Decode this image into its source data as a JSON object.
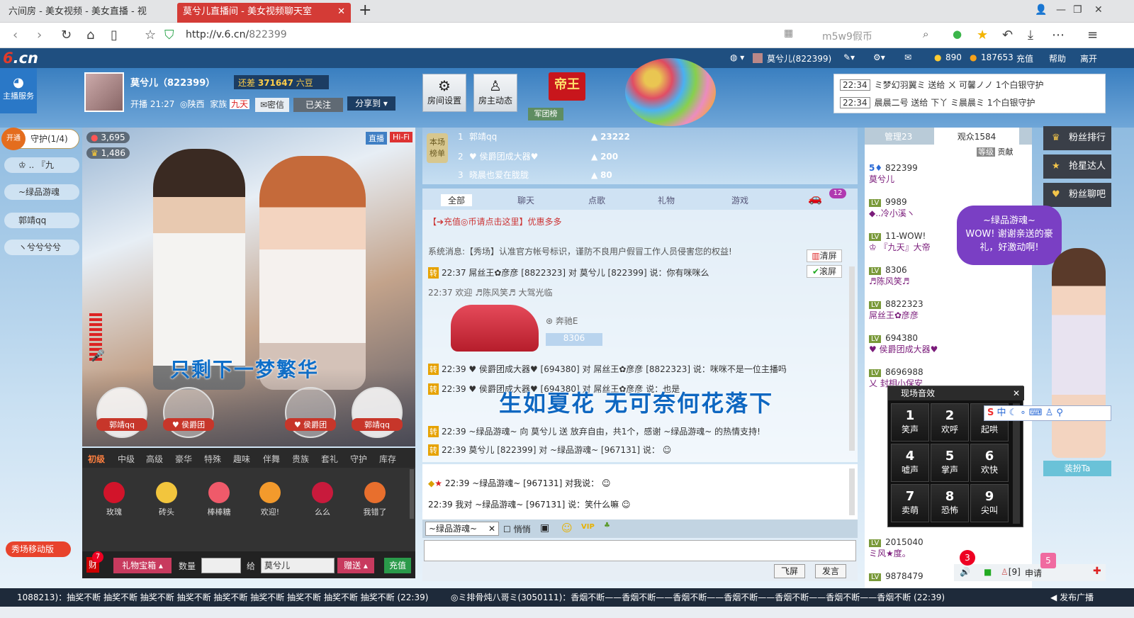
{
  "browser": {
    "tabs": [
      {
        "label": "六间房 - 美女视频 - 美女直播 - 视"
      },
      {
        "label": "莫兮儿直播间 - 美女视频聊天室"
      }
    ],
    "url_host": "http://v.6.cn/",
    "url_path": "822399",
    "search_placeholder": "m5w9假币"
  },
  "topbar": {
    "logo": "6.cn",
    "user": "莫兮儿(822399)",
    "coins": "890",
    "beans": "187653",
    "recharge": "充值",
    "help": "帮助",
    "leave": "离开"
  },
  "header": {
    "service": "主播服务",
    "host_name": "莫兮儿（822399）",
    "gold_label": "还差",
    "gold_value": "371647",
    "gold_suffix": "六豆",
    "live_time": "开播 21:27",
    "location": "陕西",
    "family_label": "家族",
    "family_tag": "九天",
    "secret": "密信",
    "followed": "已关注",
    "share": "分享到",
    "room_settings": "房间设置",
    "host_dynamic": "房主动态",
    "emperor": "帝王",
    "army": "军团榜"
  },
  "gift_notice": [
    {
      "time": "22:34",
      "text": "ミ梦幻羽翼ミ 送给 ㄨ 可馨ノノ 1个白银守护"
    },
    {
      "time": "22:34",
      "text": "晨晨二号 送给 下丫 ミ晨晨ミ 1个白银守护"
    }
  ],
  "guard": {
    "open": "开通",
    "title": "守护(1/4)",
    "members": [
      "♔ .. 『九",
      "~绿品游魂",
      "郭靖qq",
      "ヽ兮兮兮兮"
    ]
  },
  "video": {
    "wealth": "3,695",
    "fans": "1,486",
    "tag_live": "直播",
    "tag_hifi": "Hi-Fi",
    "lyric_top": "只剩下一梦繁华",
    "fan_seats": [
      "郭靖qq",
      "♥ 侯爵团",
      "♥ 侯爵团",
      "郭靖qq"
    ]
  },
  "gift_panel": {
    "tabs": [
      "初级",
      "中级",
      "高级",
      "豪华",
      "特殊",
      "趣味",
      "伴舞",
      "贵族",
      "套礼",
      "守护",
      "库存"
    ],
    "items": [
      "玫瑰",
      "砖头",
      "棒棒糖",
      "欢迎!",
      "么么",
      "我错了"
    ],
    "gift_box": "礼物宝箱",
    "qty_label": "数量",
    "to_label": "给",
    "recipient": "莫兮儿",
    "send": "赠送",
    "recharge": "充值",
    "badge": "7",
    "wealth_label": "财"
  },
  "rank": {
    "label": "本场榜单",
    "rows": [
      {
        "num": "1",
        "name": "郭靖qq",
        "score": "23222"
      },
      {
        "num": "2",
        "name": "♥ 侯爵团成大器♥",
        "score": "200"
      },
      {
        "num": "3",
        "name": "晓晨也爱在胧胧",
        "score": "80"
      }
    ]
  },
  "chat_tabs": [
    "全部",
    "聊天",
    "点歌",
    "礼物",
    "游戏"
  ],
  "car_badge": "12",
  "chat": {
    "notice": "【➔充值◎币请点击这里】优惠多多",
    "system": "系统消息:【秀场】认准官方帐号标识，谨防不良用户假冒工作人员侵害您的权益!",
    "clear": "清屏",
    "scroll": "滚屏",
    "lines": [
      "22:37 屌丝王✿彦彦 [8822323] 对 莫兮儿 [822399] 说：你有咪咪么",
      "22:37 欢迎 ♬陈风笑♬ 大驾光临",
      "22:39 ♥ 侯爵团成大器♥ [694380] 对 屌丝王✿彦彦 [8822323] 说：咪咪不是一位主播吗",
      "22:39 ♥ 侯爵团成大器♥ [694380] 对 屌丝王✿彦彦 说：也是",
      "22:39 ~绿品游魂~ 向 莫兮儿 送 放弃自由，共1个，感谢 ~绿品游魂~ 的热情支持!",
      "22:39 莫兮儿 [822399] 对 ~绿品游魂~ [967131] 说："
    ],
    "car_name": "奔驰E",
    "car_id": "8306",
    "lyric_bottom": "生如夏花  无可奈何花落下",
    "private": [
      "22:39 ~绿品游魂~ [967131] 对我说：",
      "22:39 我对 ~绿品游魂~ [967131] 说：笑什么嘛"
    ],
    "target": "~绿品游魂~",
    "whisper": "悄悄",
    "fly": "飞屏",
    "send": "发言"
  },
  "users": {
    "tab_admin": "管理23",
    "tab_audience": "观众1584",
    "rank_level": "等级",
    "rank_contrib": "贡献",
    "list": [
      {
        "id": "822399",
        "name": "莫兮儿"
      },
      {
        "id": "9989",
        "name": "◆..冷小溪ヽ"
      },
      {
        "id": "11-WOW!",
        "name": "♔ 『九天』大帝"
      },
      {
        "id": "8306",
        "name": "♬陈风笑♬"
      },
      {
        "id": "8822323",
        "name": "屌丝王✿彦彦"
      },
      {
        "id": "694380",
        "name": "♥ 侯爵团成大器♥"
      },
      {
        "id": "8696988",
        "name": "乂 封相小保安"
      },
      {
        "id": "2015040",
        "name": "ミ风★度。"
      },
      {
        "id": "9878479",
        "name": ""
      }
    ]
  },
  "right_side": {
    "fans_rank": "粉丝排行",
    "grab": "抢星达人",
    "fans_chat": "粉丝聊吧",
    "bubble_title": "~绿品游魂~",
    "bubble_text": "WOW! 谢谢亲送的豪礼，好激动啊!",
    "dress": "装扮Ta"
  },
  "sfx": {
    "title": "现场音效",
    "keys": [
      {
        "num": "1",
        "label": "笑声"
      },
      {
        "num": "2",
        "label": "欢呼"
      },
      {
        "num": "3",
        "label": "起哄"
      },
      {
        "num": "4",
        "label": "嘘声"
      },
      {
        "num": "5",
        "label": "掌声"
      },
      {
        "num": "6",
        "label": "欢快"
      },
      {
        "num": "7",
        "label": "卖萌"
      },
      {
        "num": "8",
        "label": "恐怖"
      },
      {
        "num": "9",
        "label": "尖叫"
      }
    ]
  },
  "footer": {
    "vol_badge": "3",
    "apply_badge": "5",
    "count": "[9]",
    "apply": "申请",
    "xiu": "秀场移动版",
    "marquee_left": "1088213)：抽奖不断 抽奖不断 抽奖不断 抽奖不断 抽奖不断 抽奖不断 抽奖不断 抽奖不断 抽奖不断 (22:39)",
    "marquee_right": "◎ミ排骨炖八哥ミ(3050111)：香烟不断——香烟不断——香烟不断——香烟不断——香烟不断——香烟不断——香烟不断 (22:39)",
    "broadcast": "发布广播"
  },
  "colors": {
    "brand_red": "#d43b36",
    "nav_blue": "#1f4f80",
    "gift_pink": "#c83a5e"
  }
}
